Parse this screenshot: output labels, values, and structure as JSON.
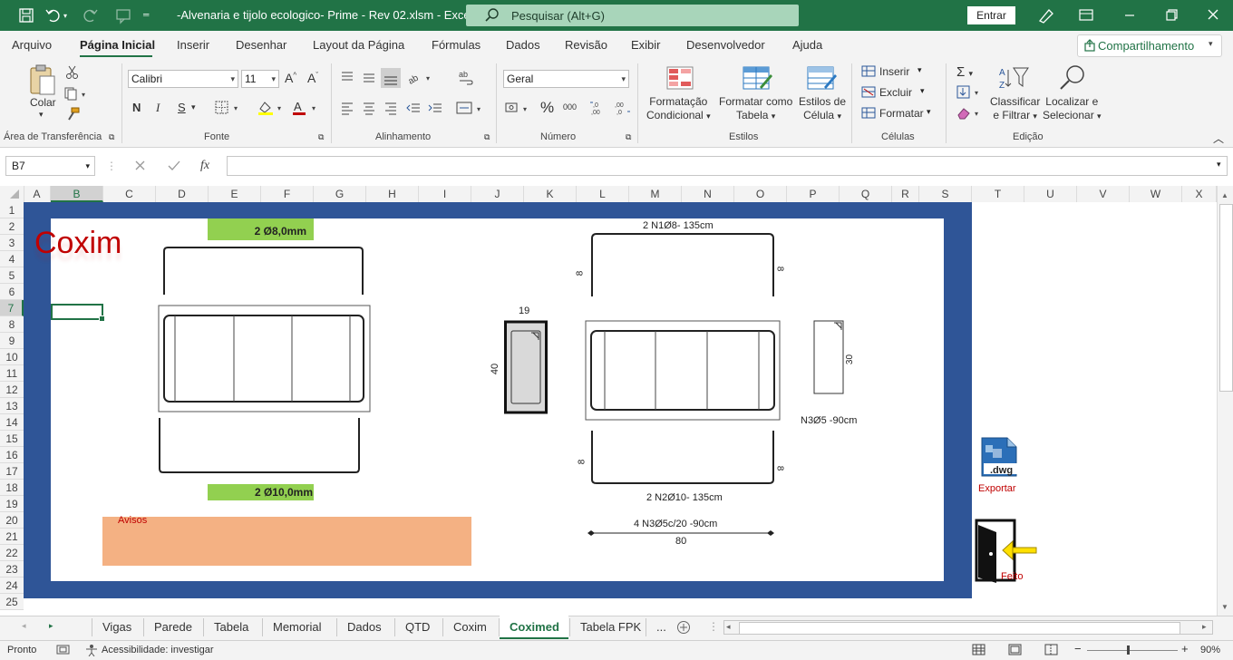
{
  "window": {
    "title": "-Alvenaria e tijolo ecologico- Prime - Rev 02.xlsm  -  Excel",
    "search_placeholder": "Pesquisar (Alt+G)",
    "signin_label": "Entrar"
  },
  "menu": {
    "tabs": [
      "Arquivo",
      "Página Inicial",
      "Inserir",
      "Desenhar",
      "Layout da Página",
      "Fórmulas",
      "Dados",
      "Revisão",
      "Exibir",
      "Desenvolvedor",
      "Ajuda"
    ],
    "active": "Página Inicial",
    "share_label": "Compartilhamento"
  },
  "ribbon": {
    "clipboard": {
      "label": "Área de Transferência",
      "paste": "Colar"
    },
    "font": {
      "label": "Fonte",
      "name": "Calibri",
      "size": "11",
      "bold": "N",
      "italic": "I",
      "underline": "S"
    },
    "alignment": {
      "label": "Alinhamento"
    },
    "number": {
      "label": "Número",
      "format": "Geral"
    },
    "styles": {
      "label": "Estilos",
      "conditional_1": "Formatação",
      "conditional_2": "Condicional",
      "as_table_1": "Formatar como",
      "as_table_2": "Tabela",
      "cell_styles_1": "Estilos de",
      "cell_styles_2": "Célula"
    },
    "cells": {
      "label": "Células",
      "insert": "Inserir",
      "delete": "Excluir",
      "format": "Formatar"
    },
    "editing": {
      "label": "Edição",
      "sort_1": "Classificar",
      "sort_2": "e Filtrar",
      "find_1": "Localizar e",
      "find_2": "Selecionar"
    }
  },
  "formula_bar": {
    "name_box": "B7",
    "fx": "fx",
    "value": ""
  },
  "columns": [
    "A",
    "B",
    "C",
    "D",
    "E",
    "F",
    "G",
    "H",
    "I",
    "J",
    "K",
    "L",
    "M",
    "N",
    "O",
    "P",
    "Q",
    "R",
    "S",
    "T",
    "U",
    "V",
    "W",
    "X"
  ],
  "rows": [
    "1",
    "2",
    "3",
    "4",
    "5",
    "6",
    "7",
    "8",
    "9",
    "10",
    "11",
    "12",
    "13",
    "14",
    "15",
    "16",
    "17",
    "18",
    "19",
    "20",
    "21",
    "22",
    "23",
    "24",
    "25"
  ],
  "sheet": {
    "heading": "Coxim",
    "top_bar_label": "2  Ø8,0mm",
    "bottom_bar_label": "2  Ø10,0mm",
    "avisos_label": "Avisos",
    "section_width": "19",
    "section_height": "40",
    "n1_label": "2 N1Ø8- 135cm",
    "n2_label": "2 N2Ø10- 135cm",
    "n3_label": "N3Ø5 -90cm",
    "stirrups_label": "4 N3Ø5c/20 -90cm",
    "length_label": "80",
    "hook_left_top": "8",
    "hook_right_top": "8",
    "hook_left_bottom": "8",
    "hook_right_bottom": "8",
    "stirrup_height": "30",
    "export_label": "Exportar",
    "dwg_ext": ".dwg",
    "done_label": "Feito",
    "colors": {
      "frame": "#2f5597",
      "green_label": "#92d050",
      "avisos_bg": "#f4b183",
      "title_red": "#c00000"
    }
  },
  "sheet_tabs": [
    "Vigas",
    "Parede",
    "Tabela",
    "Memorial",
    "Dados",
    "QTD",
    "Coxim",
    "Coximed",
    "Tabela FPK",
    "..."
  ],
  "active_sheet": "Coximed",
  "status": {
    "ready": "Pronto",
    "accessibility": "Acessibilidade: investigar",
    "zoom": "90%"
  }
}
